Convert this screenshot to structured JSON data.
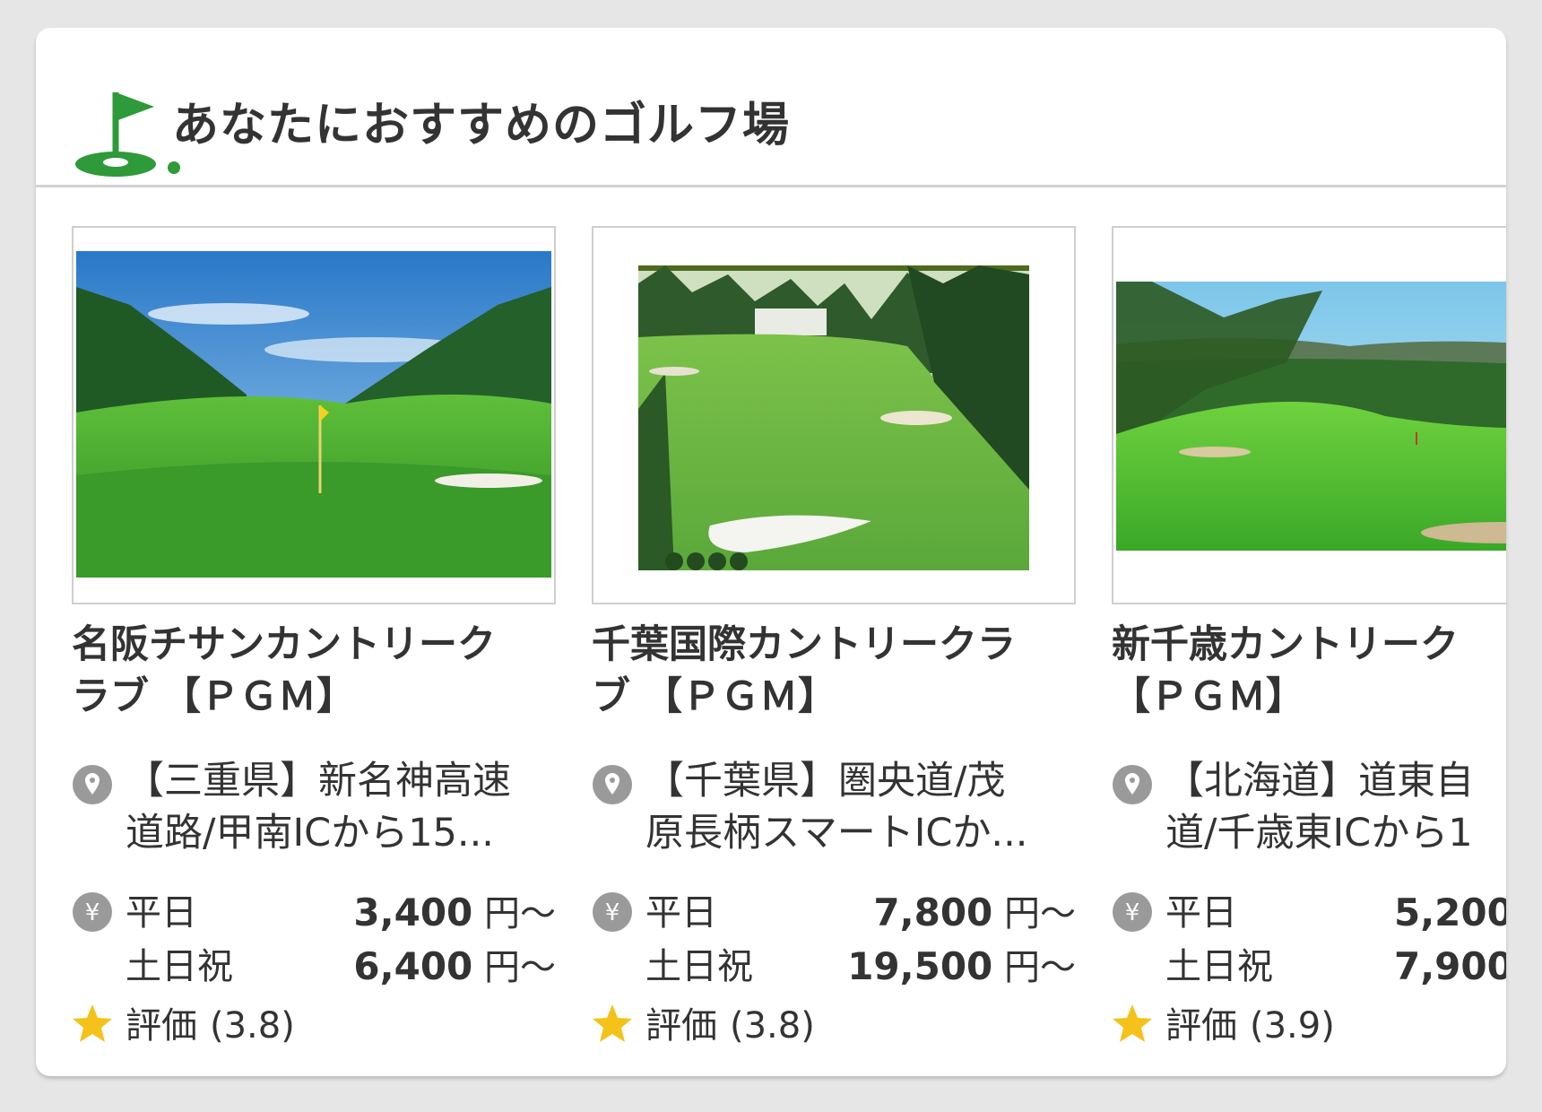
{
  "header": {
    "title": "あなたにおすすめのゴルフ場",
    "icon": "golf-flag-icon",
    "accent_color": "#2e9a3a"
  },
  "price_unit": "円〜",
  "rating_label": "評価",
  "courses": [
    {
      "name_line1": "名阪チサンカントリーク",
      "name_line2": "ラブ 【ＰＧＭ】",
      "access_line1": "【三重県】新名神高速",
      "access_line2": "道路/甲南ICから15...",
      "weekday_label": "平日",
      "weekday_price": "3,400",
      "holiday_label": "土日祝",
      "holiday_price": "6,400",
      "rating": "(3.8)"
    },
    {
      "name_line1": "千葉国際カントリークラ",
      "name_line2": "ブ 【ＰＧＭ】",
      "access_line1": "【千葉県】圏央道/茂",
      "access_line2": "原長柄スマートICか...",
      "weekday_label": "平日",
      "weekday_price": "7,800",
      "holiday_label": "土日祝",
      "holiday_price": "19,500",
      "rating": "(3.8)"
    },
    {
      "name_line1": "新千歳カントリーク",
      "name_line2": "【ＰＧＭ】",
      "access_line1": "【北海道】道東自",
      "access_line2": "道/千歳東ICから1",
      "weekday_label": "平日",
      "weekday_price": "5,200",
      "holiday_label": "土日祝",
      "holiday_price": "7,900",
      "rating": "(3.9)"
    }
  ]
}
